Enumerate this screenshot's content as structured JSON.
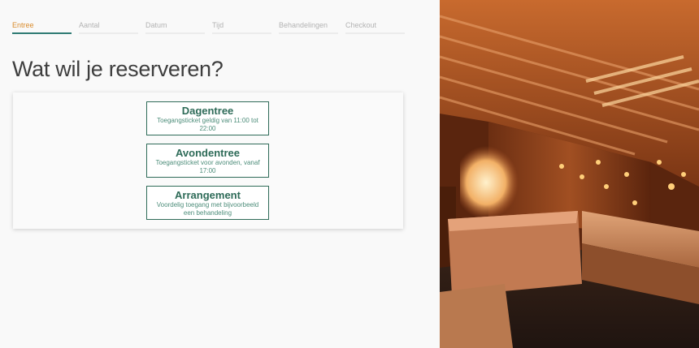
{
  "steps": [
    {
      "label": "Entree",
      "active": true
    },
    {
      "label": "Aantal",
      "active": false
    },
    {
      "label": "Datum",
      "active": false
    },
    {
      "label": "Tijd",
      "active": false
    },
    {
      "label": "Behandelingen",
      "active": false
    },
    {
      "label": "Checkout",
      "active": false
    }
  ],
  "main": {
    "heading": "Wat wil je reserveren?",
    "options": [
      {
        "title": "Dagentree",
        "description": "Toegangsticket geldig van 11:00 tot 22:00"
      },
      {
        "title": "Avondentree",
        "description": "Toegangsticket voor avonden, vanaf 17:00"
      },
      {
        "title": "Arrangement",
        "description": "Voordelig toegang met bijvoorbeeld een behandeling"
      }
    ]
  },
  "colors": {
    "accent_green": "#2e6b58",
    "active_step_text": "#d98b2b",
    "active_step_underline": "#2e7a73"
  }
}
